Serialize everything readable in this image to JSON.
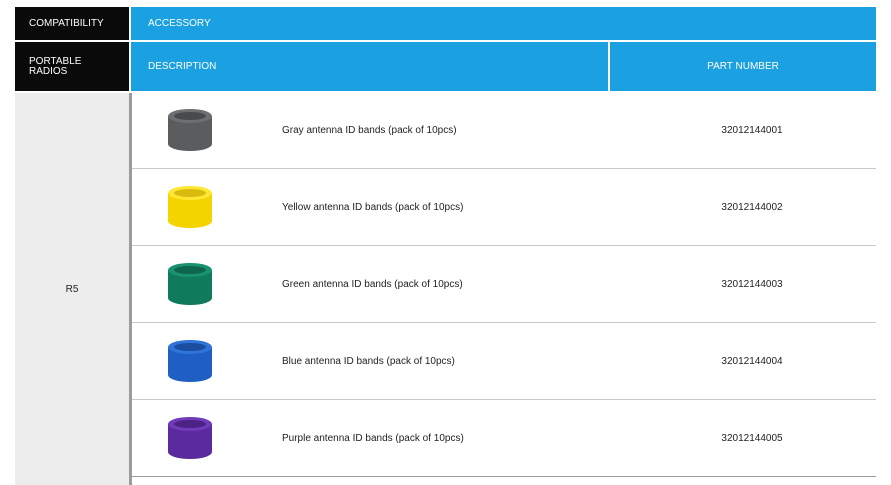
{
  "header": {
    "compatibility_label": "COMPATIBILITY",
    "accessory_label": "ACCESSORY",
    "portable_radios_label": "PORTABLE\nRADIOS",
    "description_label": "DESCRIPTION",
    "part_number_label": "PART NUMBER"
  },
  "compatibility_value": "R5",
  "colors": {
    "header_black": "#0a0a0a",
    "header_blue": "#1ba1e2",
    "compat_bg": "#ededed"
  },
  "items": [
    {
      "description": "Gray antenna ID bands (pack of 10pcs)",
      "part_number": "32012144001",
      "band_color": "#5a5c5e",
      "band_highlight": "#6d7072",
      "band_icon": "gray-band-icon"
    },
    {
      "description": "Yellow antenna ID bands (pack of 10pcs)",
      "part_number": "32012144002",
      "band_color": "#f4d400",
      "band_highlight": "#ffe733",
      "band_icon": "yellow-band-icon"
    },
    {
      "description": "Green antenna ID bands (pack of 10pcs)",
      "part_number": "32012144003",
      "band_color": "#0f7a5c",
      "band_highlight": "#1a9270",
      "band_icon": "green-band-icon"
    },
    {
      "description": "Blue antenna ID bands (pack of 10pcs)",
      "part_number": "32012144004",
      "band_color": "#1f5fc4",
      "band_highlight": "#2f74d8",
      "band_icon": "blue-band-icon"
    },
    {
      "description": "Purple antenna ID bands (pack of 10pcs)",
      "part_number": "32012144005",
      "band_color": "#5a2a9e",
      "band_highlight": "#6f3bb8",
      "band_icon": "purple-band-icon"
    }
  ]
}
